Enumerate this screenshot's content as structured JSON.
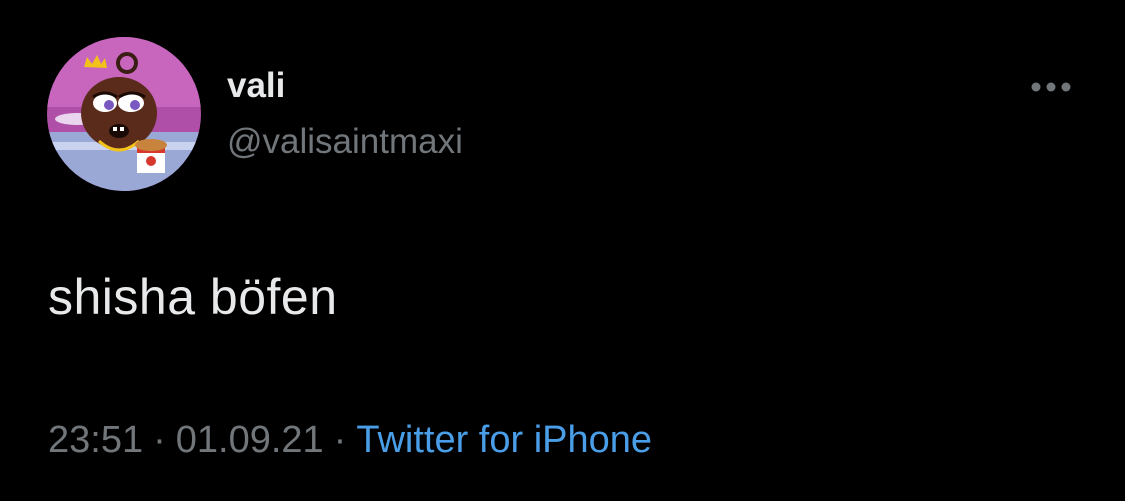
{
  "tweet": {
    "author": {
      "display_name": "vali",
      "username": "@valisaintmaxi",
      "avatar_icon": "cartoon-character-avatar"
    },
    "more_icon": "more-options-icon",
    "text": "shisha böfen",
    "time": "23:51",
    "separator": "·",
    "date": "01.09.21",
    "source": "Twitter for iPhone"
  },
  "colors": {
    "background": "#000000",
    "primary_text": "#e7e9ea",
    "secondary_text": "#71767b",
    "link": "#4a9ee8"
  }
}
